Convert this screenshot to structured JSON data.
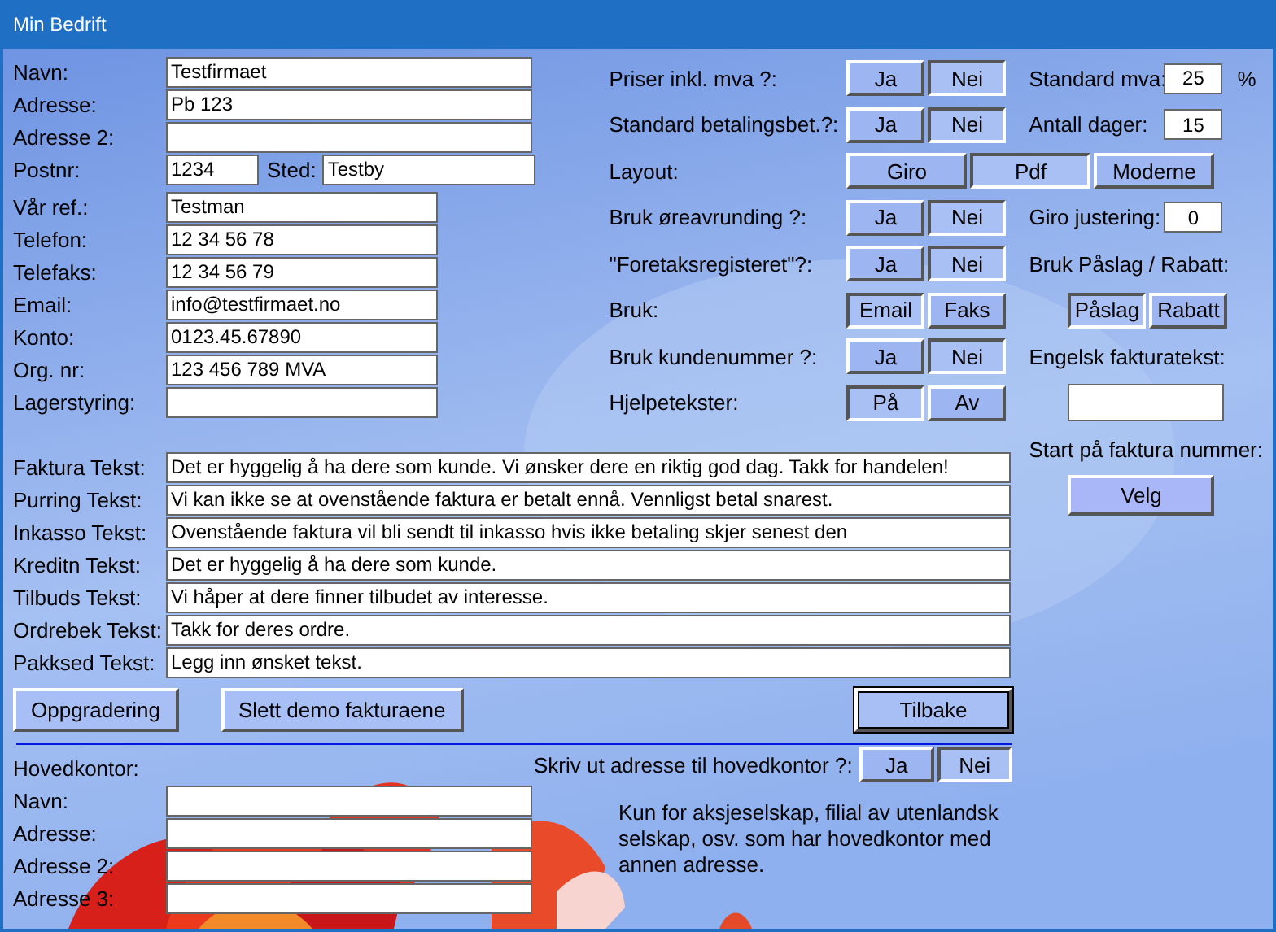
{
  "window": {
    "title": "Min Bedrift"
  },
  "company": [
    {
      "kind": "wide",
      "label": "Navn:",
      "value": "Testfirmaet"
    },
    {
      "kind": "wide",
      "label": "Adresse:",
      "value": "Pb 123"
    },
    {
      "kind": "wide",
      "label": "Adresse 2:"
    },
    {
      "kind": "postal",
      "label": "Postnr:",
      "value": "1234",
      "label_2": "Sted:",
      "value_2": "Testby"
    },
    {
      "kind": "narrow",
      "label": "Vår ref.:",
      "value": "Testman"
    },
    {
      "kind": "narrow",
      "label": "Telefon:",
      "value": "12 34 56 78"
    },
    {
      "kind": "narrow",
      "label": "Telefaks:",
      "value": "12 34 56 79"
    },
    {
      "kind": "narrow",
      "label": "Email:",
      "value": "info@testfirmaet.no"
    },
    {
      "kind": "narrow",
      "label": "Konto:",
      "value": "0123.45.67890"
    },
    {
      "kind": "narrow",
      "label": "Org. nr:",
      "value": "123 456 789 MVA"
    },
    {
      "kind": "narrow",
      "label": "Lagerstyring:"
    }
  ],
  "settings": [
    {
      "label": "Priser inkl. mva ?:",
      "options": [
        {
          "label": "Ja",
          "selected": false
        },
        {
          "label": "Nei",
          "selected": true
        }
      ]
    },
    {
      "label": "Standard betalingsbet.?:",
      "options": [
        {
          "label": "Ja",
          "selected": false
        },
        {
          "label": "Nei",
          "selected": true
        }
      ]
    },
    {
      "label": "Layout:",
      "options": [
        {
          "label": "Giro",
          "selected": false
        },
        {
          "label": "Pdf",
          "selected": true
        },
        {
          "label": "Moderne",
          "selected": false
        }
      ]
    },
    {
      "label": "Bruk øreavrunding ?:",
      "options": [
        {
          "label": "Ja",
          "selected": false
        },
        {
          "label": "Nei",
          "selected": true
        }
      ]
    },
    {
      "label": "\"Foretaksregisteret\"?:",
      "options": [
        {
          "label": "Ja",
          "selected": false
        },
        {
          "label": "Nei",
          "selected": true
        }
      ]
    },
    {
      "label": "Bruk:",
      "options": [
        {
          "label": "Email",
          "selected": true
        },
        {
          "label": "Faks",
          "selected": false
        }
      ]
    },
    {
      "label": "Bruk kundenummer ?:",
      "options": [
        {
          "label": "Ja",
          "selected": false
        },
        {
          "label": "Nei",
          "selected": true
        }
      ]
    },
    {
      "label": "Hjelpetekster:",
      "options": [
        {
          "label": "På",
          "selected": true
        },
        {
          "label": "Av",
          "selected": false
        }
      ]
    }
  ],
  "side": [
    {
      "kind": "field",
      "label": "Standard mva:",
      "value": "25",
      "unit": "%"
    },
    {
      "kind": "field",
      "label": "Antall dager:",
      "value": "15"
    },
    {
      "kind": "blank"
    },
    {
      "kind": "field",
      "label": "Giro justering:",
      "value": "0"
    },
    {
      "kind": "heading",
      "label": "Bruk Påslag / Rabatt:"
    },
    {
      "kind": "toggle",
      "options": [
        {
          "label": "Påslag",
          "selected": true
        },
        {
          "label": "Rabatt",
          "selected": false
        }
      ]
    },
    {
      "kind": "heading",
      "label": "Engelsk fakturatekst:"
    },
    {
      "kind": "input"
    },
    {
      "kind": "heading",
      "label": "Start på faktura nummer:"
    },
    {
      "kind": "button",
      "label": "Velg"
    }
  ],
  "texts": [
    {
      "label": "Faktura Tekst:",
      "value": "Det er hyggelig å ha dere som kunde. Vi ønsker dere en riktig god dag. Takk for handelen!"
    },
    {
      "label": "Purring Tekst:",
      "value": "Vi kan ikke se at ovenstående faktura er betalt ennå. Vennligst betal snarest."
    },
    {
      "label": "Inkasso Tekst:",
      "value": "Ovenstående faktura vil bli sendt til inkasso hvis ikke betaling skjer senest den"
    },
    {
      "label": "Kreditn Tekst:",
      "value": "Det er hyggelig å ha dere som kunde."
    },
    {
      "label": "Tilbuds Tekst:",
      "value": "Vi håper at dere finner tilbudet av interesse."
    },
    {
      "label": "Ordrebek Tekst:",
      "value": "Takk for deres ordre."
    },
    {
      "label": "Pakksed Tekst:",
      "value": "Legg inn ønsket tekst."
    }
  ],
  "actions": [
    {
      "label": "Oppgradering",
      "focused": false
    },
    {
      "label": "Slett demo fakturaene",
      "focused": false
    },
    {
      "label": "Tilbake",
      "focused": true
    }
  ],
  "head_office": {
    "title": "Hovedkontor:",
    "fields": [
      {
        "label": "Navn:"
      },
      {
        "label": "Adresse:"
      },
      {
        "label": "Adresse 2:"
      },
      {
        "label": "Adresse 3:"
      }
    ],
    "print": {
      "label": "Skriv ut adresse til hovedkontor ?:",
      "options": [
        {
          "label": "Ja",
          "selected": false
        },
        {
          "label": "Nei",
          "selected": true
        }
      ]
    },
    "note": "Kun for aksjeselskap, filial av utenlandsk selskap, osv. som har hovedkontor med annen adresse."
  }
}
